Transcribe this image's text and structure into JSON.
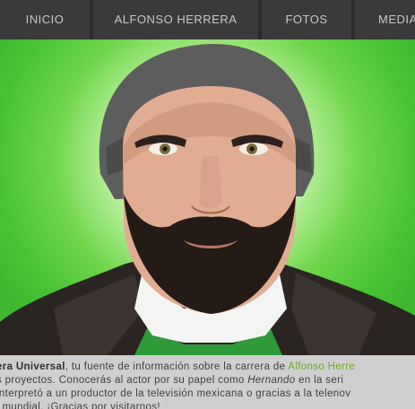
{
  "nav": {
    "items": [
      {
        "label": "INICIO"
      },
      {
        "label": "ALFONSO HERRERA"
      },
      {
        "label": "FOTOS"
      },
      {
        "label": "MEDIA"
      }
    ]
  },
  "hero": {
    "image": "portrait-photo",
    "colors": {
      "background": "#46c233",
      "center_glow": "#ffffff"
    }
  },
  "bio": {
    "line1": {
      "site_name": "era Universal",
      "text_a": ", tu fuente de información sobre la carrera de ",
      "link": "Alfonso Herre"
    },
    "line2": {
      "text_a": "s proyectos. Conocerás al actor por su papel como ",
      "em": "Hernando",
      "text_b": " en la seri"
    },
    "line3": {
      "text": " interpretó a un productor de la televisión mexicana o gracias a la telenov"
    },
    "line4": {
      "text": "l mundial. ¡Gracias por visitarnos!"
    }
  },
  "colors": {
    "navbar": "#3a3a3a",
    "nav_text": "#c9c9c9",
    "link": "#6fa82a",
    "body_bg": "#cfcfcf"
  }
}
